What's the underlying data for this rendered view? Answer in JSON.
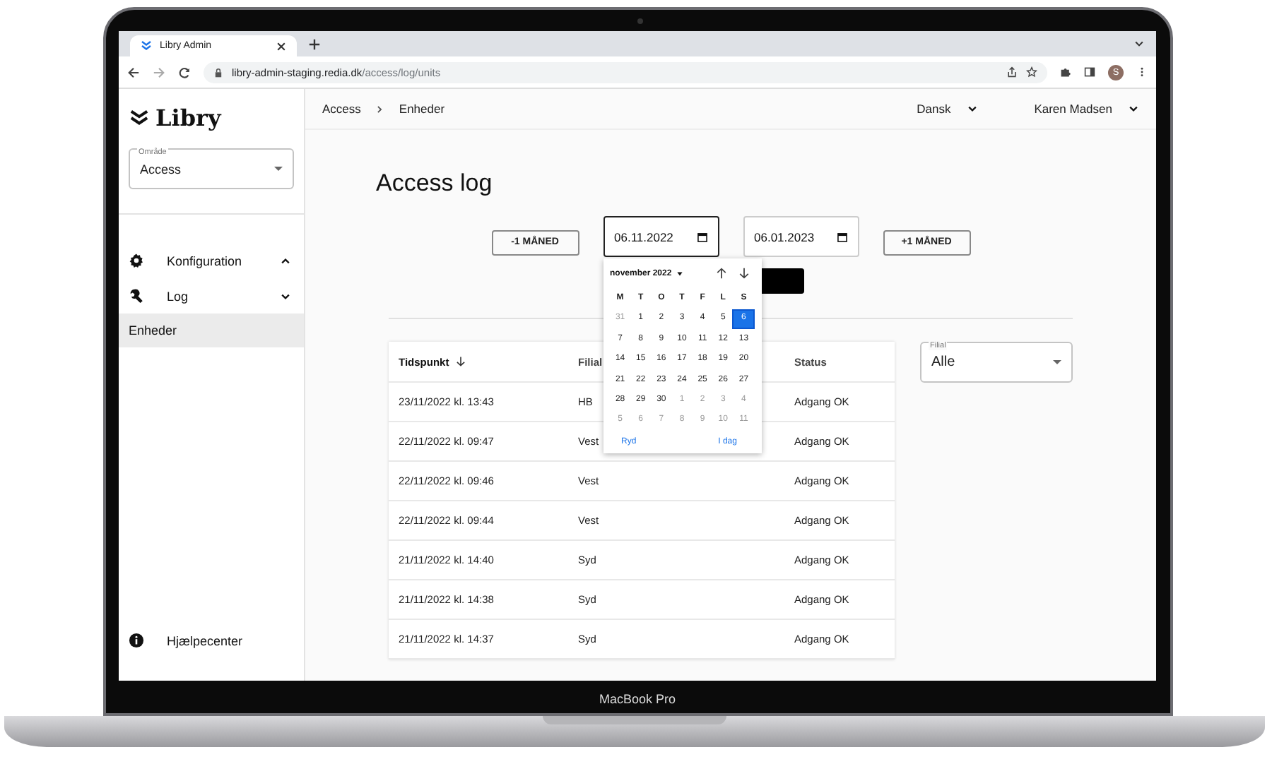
{
  "browser": {
    "tab": {
      "title": "Libry Admin"
    },
    "url": {
      "host": "libry-admin-staging.redia.dk",
      "path": "/access/log/units"
    },
    "profile_initial": "S"
  },
  "sidebar": {
    "logo": "Libry",
    "area_select": {
      "label": "Område",
      "value": "Access"
    },
    "nav": [
      {
        "label": "Konfiguration",
        "expanded": true
      },
      {
        "label": "Log",
        "expanded": false,
        "children": [
          {
            "label": "Enheder",
            "selected": true
          }
        ]
      }
    ],
    "help": {
      "label": "Hjælpecenter"
    }
  },
  "topbar": {
    "breadcrumbs": [
      "Access",
      "Enheder"
    ],
    "language": "Dansk",
    "user": "Karen Madsen"
  },
  "page": {
    "title": "Access log",
    "prev_button": "-1 MÅNED",
    "next_button": "+1 MÅNED",
    "date_from": "06.11.2022",
    "date_to": "06.01.2023"
  },
  "calendar": {
    "month": "november 2022",
    "weekdays": [
      "M",
      "T",
      "O",
      "T",
      "F",
      "L",
      "S"
    ],
    "weeks": [
      [
        {
          "label": "31",
          "muted": true,
          "selected": false
        },
        {
          "label": "1",
          "muted": false,
          "selected": false
        },
        {
          "label": "2",
          "muted": false,
          "selected": false
        },
        {
          "label": "3",
          "muted": false,
          "selected": false
        },
        {
          "label": "4",
          "muted": false,
          "selected": false
        },
        {
          "label": "5",
          "muted": false,
          "selected": false
        },
        {
          "label": "6",
          "muted": false,
          "selected": true
        }
      ],
      [
        {
          "label": "7",
          "muted": false,
          "selected": false
        },
        {
          "label": "8",
          "muted": false,
          "selected": false
        },
        {
          "label": "9",
          "muted": false,
          "selected": false
        },
        {
          "label": "10",
          "muted": false,
          "selected": false
        },
        {
          "label": "11",
          "muted": false,
          "selected": false
        },
        {
          "label": "12",
          "muted": false,
          "selected": false
        },
        {
          "label": "13",
          "muted": false,
          "selected": false
        }
      ],
      [
        {
          "label": "14",
          "muted": false,
          "selected": false
        },
        {
          "label": "15",
          "muted": false,
          "selected": false
        },
        {
          "label": "16",
          "muted": false,
          "selected": false
        },
        {
          "label": "17",
          "muted": false,
          "selected": false
        },
        {
          "label": "18",
          "muted": false,
          "selected": false
        },
        {
          "label": "19",
          "muted": false,
          "selected": false
        },
        {
          "label": "20",
          "muted": false,
          "selected": false
        }
      ],
      [
        {
          "label": "21",
          "muted": false,
          "selected": false
        },
        {
          "label": "22",
          "muted": false,
          "selected": false
        },
        {
          "label": "23",
          "muted": false,
          "selected": false
        },
        {
          "label": "24",
          "muted": false,
          "selected": false
        },
        {
          "label": "25",
          "muted": false,
          "selected": false
        },
        {
          "label": "26",
          "muted": false,
          "selected": false
        },
        {
          "label": "27",
          "muted": false,
          "selected": false
        }
      ],
      [
        {
          "label": "28",
          "muted": false,
          "selected": false
        },
        {
          "label": "29",
          "muted": false,
          "selected": false
        },
        {
          "label": "30",
          "muted": false,
          "selected": false
        },
        {
          "label": "1",
          "muted": true,
          "selected": false
        },
        {
          "label": "2",
          "muted": true,
          "selected": false
        },
        {
          "label": "3",
          "muted": true,
          "selected": false
        },
        {
          "label": "4",
          "muted": true,
          "selected": false
        }
      ],
      [
        {
          "label": "5",
          "muted": true,
          "selected": false
        },
        {
          "label": "6",
          "muted": true,
          "selected": false
        },
        {
          "label": "7",
          "muted": true,
          "selected": false
        },
        {
          "label": "8",
          "muted": true,
          "selected": false
        },
        {
          "label": "9",
          "muted": true,
          "selected": false
        },
        {
          "label": "10",
          "muted": true,
          "selected": false
        },
        {
          "label": "11",
          "muted": true,
          "selected": false
        }
      ]
    ],
    "clear": "Ryd",
    "today": "I dag"
  },
  "table": {
    "columns": [
      {
        "label": "Tidspunkt",
        "sorted": true
      },
      {
        "label": "Filial",
        "sorted": false
      },
      {
        "label": "Status",
        "sorted": false
      }
    ],
    "rows": [
      [
        "23/11/2022 kl. 13:43",
        "HB",
        "Adgang OK"
      ],
      [
        "22/11/2022 kl. 09:47",
        "Vest",
        "Adgang OK"
      ],
      [
        "22/11/2022 kl. 09:46",
        "Vest",
        "Adgang OK"
      ],
      [
        "22/11/2022 kl. 09:44",
        "Vest",
        "Adgang OK"
      ],
      [
        "21/11/2022 kl. 14:40",
        "Syd",
        "Adgang OK"
      ],
      [
        "21/11/2022 kl. 14:38",
        "Syd",
        "Adgang OK"
      ],
      [
        "21/11/2022 kl. 14:37",
        "Syd",
        "Adgang OK"
      ]
    ]
  },
  "filter": {
    "label": "Filial",
    "value": "Alle"
  },
  "device": {
    "label": "MacBook Pro"
  }
}
